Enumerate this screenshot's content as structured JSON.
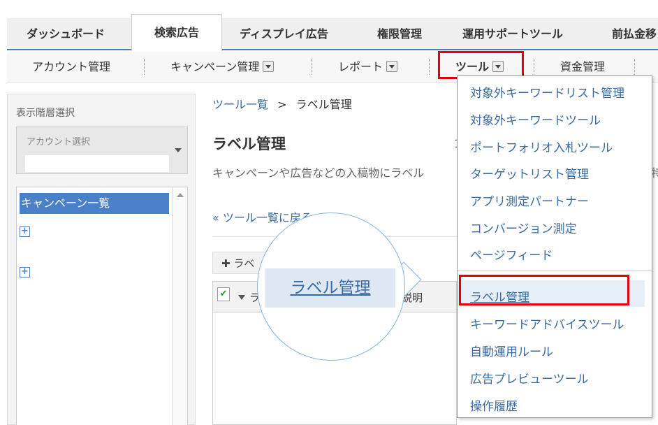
{
  "top_tabs": [
    "ダッシュボード",
    "検索広告",
    "ディスプレイ広告",
    "権限管理",
    "運用サポートツール",
    "前払金移"
  ],
  "sub_nav": {
    "account": "アカウント管理",
    "campaign": "キャンペーン管理",
    "report": "レポート",
    "tools": "ツール",
    "funds": "資金管理"
  },
  "sidebar": {
    "title": "表示階層選択",
    "account_select_label": "アカウント選択",
    "tree_selected": "キャンペーン一覧",
    "expand_symbol": "+"
  },
  "main": {
    "breadcrumb_parent": "ツール一覧",
    "breadcrumb_sep": ">",
    "breadcrumb_current": "ラベル管理",
    "title": "ラベル管理",
    "description": "キャンペーンや広告などの入稿物にラベル",
    "desc_tail": "特",
    "c1": "1",
    "back_link": "« ツール一覧に戻る",
    "add_button": "ラベ",
    "table_label_header": "ラ",
    "table_desc_header": "説明"
  },
  "zoom_label": "ラベル管理",
  "tools_menu": {
    "items": [
      "対象外キーワードリスト管理",
      "対象外キーワードツール",
      "ポートフォリオ入札ツール",
      "ターゲットリスト管理",
      "アプリ測定パートナー",
      "コンバージョン測定",
      "ページフィード"
    ],
    "items2": [
      "ラベル管理",
      "キーワードアドバイスツール",
      "自動運用ルール",
      "広告プレビューツール",
      "操作履歴"
    ],
    "selected": "ラベル管理"
  },
  "colors": {
    "accent": "#4a7fc0",
    "highlight": "#e0000a",
    "link": "#3b6aa0"
  }
}
